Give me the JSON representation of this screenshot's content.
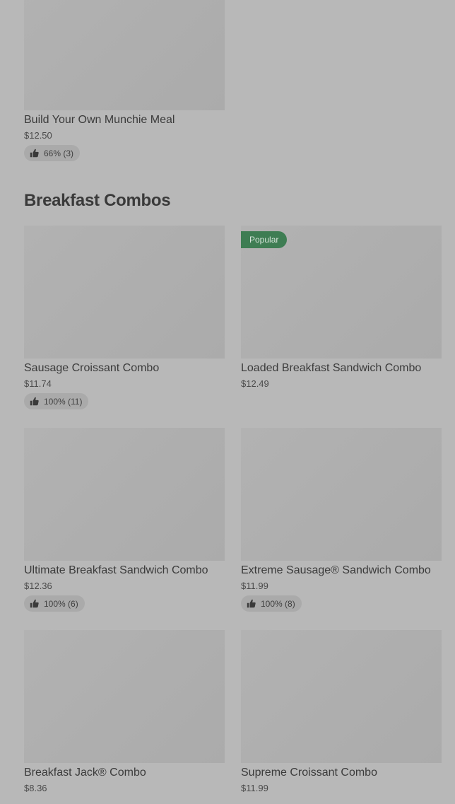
{
  "top_item": {
    "title": "Build Your Own Munchie Meal",
    "price": "$12.50",
    "rating": "66% (3)"
  },
  "section": {
    "title": "Breakfast Combos"
  },
  "items": [
    {
      "title": "Sausage Croissant Combo",
      "price": "$11.74",
      "rating": "100% (11)"
    },
    {
      "title": "Loaded Breakfast Sandwich Combo",
      "price": "$12.49",
      "badge": "Popular"
    },
    {
      "title": "Ultimate Breakfast Sandwich Combo",
      "price": "$12.36",
      "rating": "100% (6)"
    },
    {
      "title": "Extreme Sausage® Sandwich Combo",
      "price": "$11.99",
      "rating": "100% (8)"
    },
    {
      "title": "Breakfast Jack® Combo",
      "price": "$8.36"
    },
    {
      "title": "Supreme Croissant Combo",
      "price": "$11.99"
    }
  ],
  "colors": {
    "background": "#b8b8b8",
    "badge": "#3e7d53"
  },
  "icons": {
    "rating": "thumbs-up-icon"
  }
}
